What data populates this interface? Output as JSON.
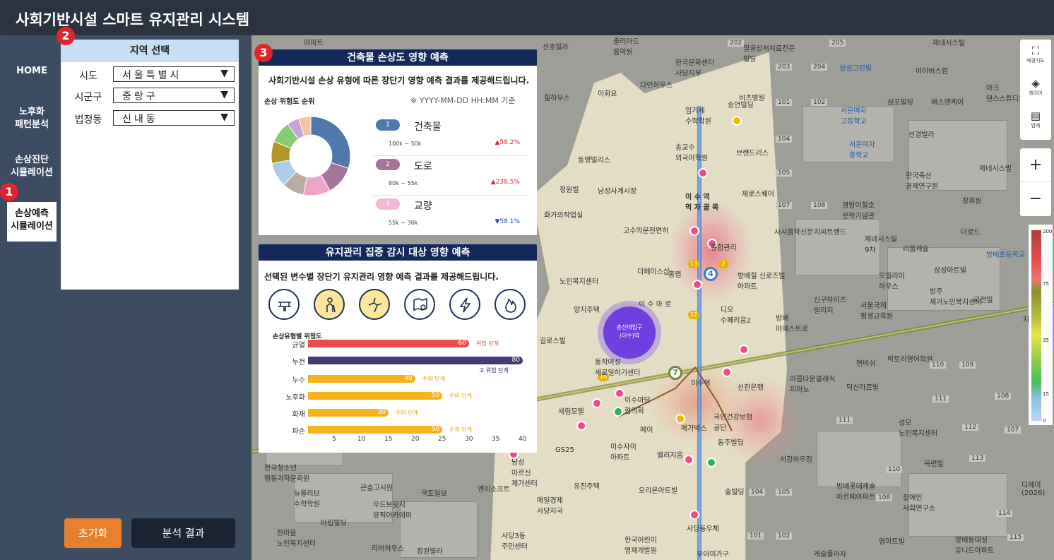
{
  "app": {
    "title": "사회기반시설 스마트 유지관리 시스템"
  },
  "nav": {
    "items": [
      {
        "label": "HOME"
      },
      {
        "label": "노후화\n패턴분석"
      },
      {
        "label": "손상진단\n시뮬레이션"
      },
      {
        "label": "손상예측\n시뮬레이션",
        "active": true
      }
    ]
  },
  "badges": {
    "one": "1",
    "two": "2",
    "three": "3"
  },
  "region": {
    "title": "지역 선택",
    "fields": [
      {
        "label": "시도",
        "value": "서울특별시"
      },
      {
        "label": "시군구",
        "value": "중랑구"
      },
      {
        "label": "법정동",
        "value": "신내동"
      }
    ],
    "arrow": "▼"
  },
  "buttons": {
    "reset": "초기화",
    "result": "분석 결과"
  },
  "panel1": {
    "header": "건축물 손상도 영향 예측",
    "subtitle": "사회기반시설 손상 유형에 따른 장단기 영향 예측 결과를 제공해드립니다.",
    "rank_title": "손상 위험도 순위",
    "date_note": "※ YYYY-MM-DD HH:MM 기준",
    "donut": {
      "slices": [
        {
          "value": 30,
          "color": "#4f79ad"
        },
        {
          "value": 12,
          "color": "#a5769a"
        },
        {
          "value": 11,
          "color": "#f0a6c8"
        },
        {
          "value": 9,
          "color": "#b9aca5"
        },
        {
          "value": 10,
          "color": "#a8cdeb"
        },
        {
          "value": 9,
          "color": "#b09628"
        },
        {
          "value": 9,
          "color": "#86cd72"
        },
        {
          "value": 5,
          "color": "#c9a4d8"
        },
        {
          "value": 5,
          "color": "#f6c4a2"
        }
      ]
    },
    "ranks": [
      {
        "num": "1",
        "name": "건축물",
        "range": "100k ~ 50k",
        "change": "▲58.2%",
        "color": "#4f79ad",
        "dir": "up"
      },
      {
        "num": "2",
        "name": "도로",
        "range": "80k ~ 55k",
        "change": "▲238.5%",
        "color": "#a5769a",
        "dir": "up"
      },
      {
        "num": "3",
        "name": "교량",
        "range": "55k ~ 30k",
        "change": "▼58.1%",
        "color": "#f4b6d2",
        "dir": "down"
      }
    ]
  },
  "panel2": {
    "header": "유지관리 집중 감시 대상 영향 예측",
    "subtitle": "선택된 변수별 장단기 유지관리 영향 예측 결과를 제공해드립니다.",
    "icons": [
      {
        "name": "pipe-icon",
        "active": false
      },
      {
        "name": "elderly-person-icon",
        "active": true
      },
      {
        "name": "crack-icon",
        "active": true
      },
      {
        "name": "leak-map-icon",
        "active": false
      },
      {
        "name": "lightning-icon",
        "active": false
      },
      {
        "name": "fire-icon",
        "active": false
      }
    ],
    "bar_title": "손상유형별 위험도",
    "bars": [
      {
        "label": "균열",
        "value": 60,
        "stage": "위험 단계",
        "color": "#e94e4e",
        "stage_color": "#e94e4e"
      },
      {
        "label": "누전",
        "value": 80,
        "stage": "고 위험 단계",
        "color": "#463a73",
        "stage_color": "#1f2f57"
      },
      {
        "label": "누수",
        "value": 40,
        "stage": "주의 단계",
        "color": "#f7b21c",
        "stage_color": "#e8a000"
      },
      {
        "label": "노후화",
        "value": 50,
        "stage": "주의 단계",
        "color": "#f7b21c",
        "stage_color": "#e8a000"
      },
      {
        "label": "화재",
        "value": 30,
        "stage": "주의 단계",
        "color": "#f7b21c",
        "stage_color": "#e8a000"
      },
      {
        "label": "파손",
        "value": 50,
        "stage": "주의 단계",
        "color": "#f7b21c",
        "stage_color": "#e8a000"
      }
    ],
    "axis_ticks": [
      "5",
      "10",
      "15",
      "20",
      "25",
      "30",
      "35",
      "40"
    ]
  },
  "map": {
    "center_marker": "총신대입구\n(이수)역",
    "labels": [
      "아파트",
      "선호빌라",
      "줄리아드\n음악원",
      "한국문화센터\n사당지부",
      "얼굴상처치료전문\n빌딩",
      "제네시스빌",
      "이화요",
      "다인하우스",
      "비츠병원",
      "삼성그린빌",
      "아이버스컴",
      "임기세\n수학학원",
      "송언빌딩",
      "힐하우스",
      "서문여자\n고등학교",
      "삼포빌딩",
      "애스앤케이",
      "동명빌리스",
      "송교수\n외국어학원",
      "브랜드리스",
      "선경빌라",
      "서문여자\n중학교",
      "정원빌",
      "남성사계시장",
      "이 수 역\n먹 자 골 목",
      "제로스퀘어",
      "한국축산\n경제연구원",
      "창휘원",
      "경암이철호\n문학기념관",
      "화가의작업실",
      "고수의운전면허",
      "사시음악신문",
      "지씨트랜드",
      "제네시스빌\n9차",
      "리움캐슬",
      "더로드",
      "방배초등학교",
      "종합관리",
      "더페이스샵",
      "홈랩",
      "방배힐 신로즈빌\n아파트",
      "오필리아\n하우스",
      "방주\n제가노인복지센터",
      "국전빌",
      "상성아트빌",
      "노인복지센터",
      "양지주택",
      "이 수 마 로",
      "신구하이츠\n빌리지",
      "서울국제\n평생교육원",
      "디오\n수페리움2",
      "방배\n마에스트로",
      "길로스빌",
      "엔비쉬",
      "빅토리영어학원",
      "동작여성\n새로일하기센터",
      "이수역",
      "신한은행",
      "아름다운클래식\n피아노",
      "덕산라르빌",
      "세림모텔",
      "이수마당\n협의회",
      "메이",
      "메가박스",
      "국민건강보험\n공단",
      "성모\n노인복지센터",
      "동주빌딩",
      "GS25",
      "이수자이\n아파트",
      "엘리지움",
      "서강하우징",
      "목련빌",
      "남성\n아르신\n제가센터",
      "유진주택",
      "한국청소년\n행동과학문화원",
      "큰솔고시원",
      "엔이소프트",
      "오리온아트빌",
      "뉴올리브\n수학학원",
      "국토일보",
      "매일경제\n사당지국",
      "솔빌딩",
      "방배롯데캐슬\n아르떼아파트",
      "장애인\n사회연구소",
      "우드브릿지\n뮤직아카데미",
      "마립빌딩",
      "사당동우체",
      "한마음\n노인복지센터",
      "리버하우스",
      "장원빌라",
      "사당3동\n주민센터",
      "한국어린이\n영재개발원",
      "우아미가구",
      "캐슬플라자",
      "영아트빌",
      "방배동대성\n유니드아파트",
      "디에이\n(2026)",
      "아크\n댄스스튜디오",
      "제네시스빌",
      "지예아"
    ],
    "district_numbers": [
      "202",
      "205",
      "203",
      "204",
      "101",
      "102",
      "104",
      "105",
      "107",
      "108",
      "110",
      "109",
      "111",
      "108",
      "112",
      "107",
      "113",
      "111",
      "110",
      "108",
      "105",
      "104",
      "102",
      "101",
      "114",
      "115"
    ],
    "station_numbers": [
      "4",
      "7",
      "13",
      "12",
      "10",
      "2"
    ]
  },
  "toolbar": {
    "tools": [
      {
        "icon": "map-icon",
        "glyph": "⛶",
        "label": "배경지도"
      },
      {
        "icon": "layers-icon",
        "glyph": "◈",
        "label": "레이어"
      },
      {
        "icon": "legend-icon",
        "glyph": "▤",
        "label": "범례"
      }
    ],
    "zoom_in": "+",
    "zoom_out": "−"
  },
  "heat_legend": {
    "ticks": [
      "200",
      "75",
      "35",
      "15",
      "0"
    ]
  }
}
